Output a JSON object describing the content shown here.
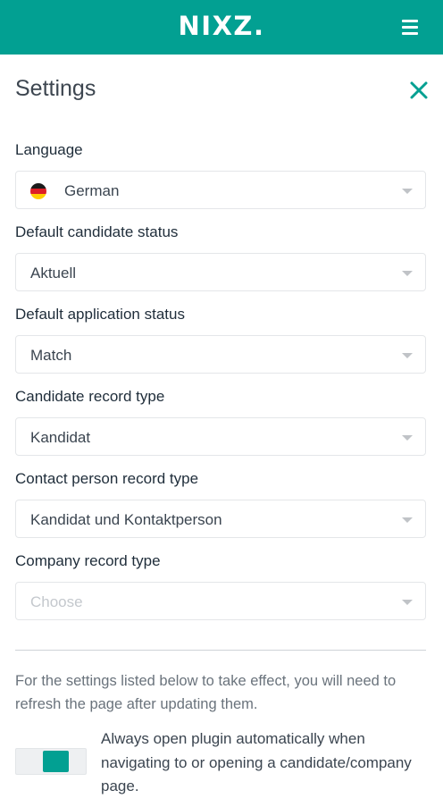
{
  "header": {
    "logo": "NIXZ.",
    "menu_icon": "hamburger-menu-icon"
  },
  "panel": {
    "title": "Settings",
    "close_icon": "close-icon"
  },
  "fields": {
    "language": {
      "label": "Language",
      "value": "German",
      "flag": "germany-flag-icon"
    },
    "candidate_status": {
      "label": "Default candidate status",
      "value": "Aktuell"
    },
    "application_status": {
      "label": "Default application status",
      "value": "Match"
    },
    "candidate_record_type": {
      "label": "Candidate record type",
      "value": "Kandidat"
    },
    "contact_record_type": {
      "label": "Contact person record type",
      "value": "Kandidat und Kontaktperson"
    },
    "company_record_type": {
      "label": "Company record type",
      "value": "",
      "placeholder": "Choose"
    }
  },
  "refresh_note": "For the settings listed below to take effect, you will need to refresh the page after updating them.",
  "auto_open": {
    "label": "Always open plugin automatically when navigating to or opening a candidate/company page.",
    "enabled": true
  },
  "colors": {
    "accent": "#02a092",
    "flag_black": "#1b1b1b",
    "flag_red": "#dd1f26",
    "flag_gold": "#ffce00"
  }
}
